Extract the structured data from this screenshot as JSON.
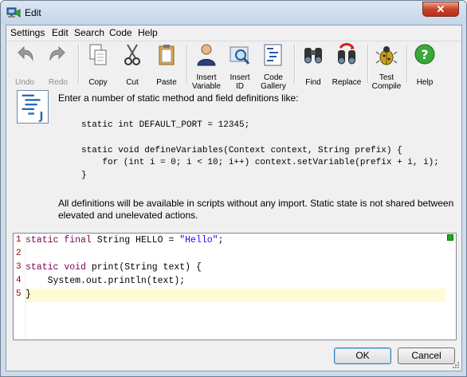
{
  "window": {
    "title": "Edit",
    "close_glyph": "✕"
  },
  "menu": [
    "Settings",
    "Edit",
    "Search",
    "Code",
    "Help"
  ],
  "toolbar": {
    "undo": "Undo",
    "redo": "Redo",
    "copy": "Copy",
    "cut": "Cut",
    "paste": "Paste",
    "insert_variable": [
      "Insert",
      "Variable"
    ],
    "insert_id": [
      "Insert",
      "ID"
    ],
    "code_gallery": [
      "Code",
      "Gallery"
    ],
    "find": "Find",
    "replace": "Replace",
    "test_compile": [
      "Test",
      "Compile"
    ],
    "help": "Help"
  },
  "info": {
    "intro": "Enter a number of static method and field definitions like:",
    "sample": [
      "static int DEFAULT_PORT = 12345;",
      "",
      "static void defineVariables(Context context, String prefix) {",
      "    for (int i = 0; i < 10; i++) context.setVariable(prefix + i, i);",
      "}"
    ],
    "note": "All definitions will be available in scripts without any import. Static state is not shared between elevated and unelevated actions."
  },
  "editor": {
    "line_numbers": [
      "1",
      "2",
      "3",
      "4",
      "5"
    ],
    "lines": {
      "l1_kw": "static final",
      "l1_rest": " String HELLO = ",
      "l1_str": "\"Hello\"",
      "l1_end": ";",
      "l3_kw1": "static",
      "l3_sp": " ",
      "l3_kw2": "void",
      "l3_rest": " print(String text) {",
      "l4": "    System.out.println(text);",
      "l5": "}"
    }
  },
  "buttons": {
    "ok": "OK",
    "cancel": "Cancel"
  },
  "colors": {
    "keyword": "#7f0055",
    "string": "#2a00ff",
    "current_line": "#fefad5",
    "status_ok": "#22a822"
  }
}
